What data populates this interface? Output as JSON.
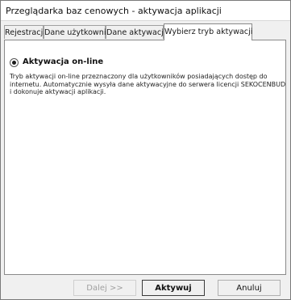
{
  "window": {
    "title": "Przeglądarka baz cenowych - aktywacja aplikacji"
  },
  "tabs": [
    {
      "label": "Rejestracja",
      "active": false
    },
    {
      "label": "Dane użytkownika",
      "active": false
    },
    {
      "label": "Dane aktywacji",
      "active": false
    },
    {
      "label": "Wybierz tryb aktywacji",
      "active": true
    }
  ],
  "panel": {
    "option": {
      "label": "Aktywacja on-line",
      "selected": true
    },
    "description_lines": [
      "Tryb aktywacji on-line przeznaczony dla użytkowników posiadających dostęp do",
      "internetu. Automatycznie wysyła dane aktywacyjne do serwera licencji SEKOCENBUD",
      "i dokonuje aktywacji aplikacji."
    ]
  },
  "buttons": {
    "next_label": "Dalej >>",
    "activate_label": "Aktywuj",
    "cancel_label": "Anuluj"
  },
  "colors": {
    "window_bg": "#f0f0f0",
    "panel_bg": "#ffffff",
    "disabled_text": "#a0a0a0"
  }
}
